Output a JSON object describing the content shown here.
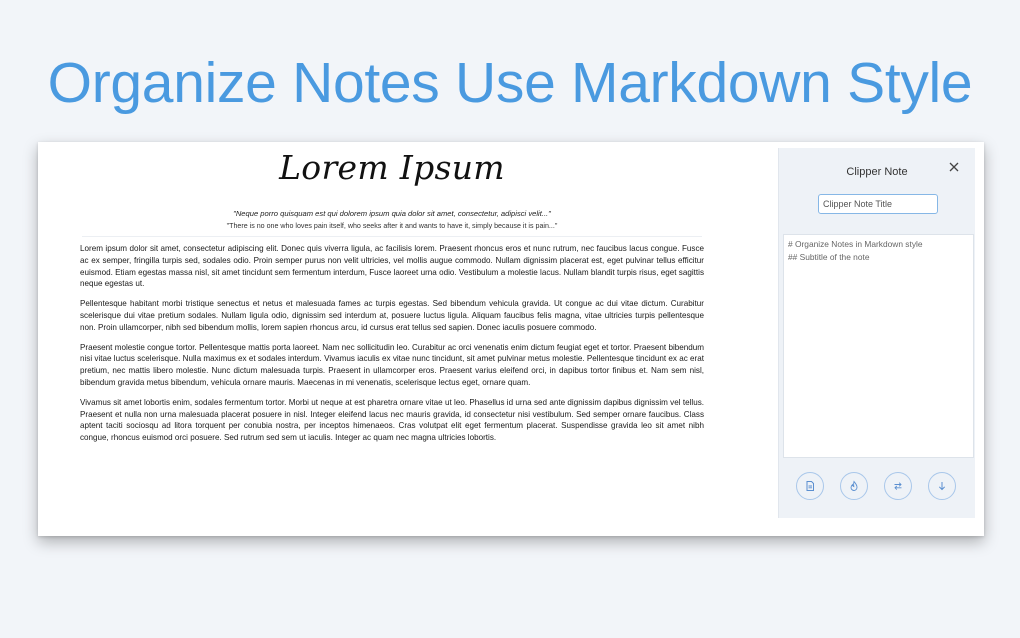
{
  "headline": "Organize Notes Use Markdown Style",
  "article": {
    "title": "Lorem Ipsum",
    "quote": "\"Neque porro quisquam est qui dolorem ipsum quia dolor sit amet, consectetur, adipisci velit...\"",
    "quote_translation": "\"There is no one who loves pain itself, who seeks after it and wants to have it, simply because it is pain...\"",
    "paragraphs": [
      "Lorem ipsum dolor sit amet, consectetur adipiscing elit. Donec quis viverra ligula, ac facilisis lorem. Praesent rhoncus eros et nunc rutrum, nec faucibus lacus congue. Fusce ac ex semper, fringilla turpis sed, sodales odio. Proin semper purus non velit ultricies, vel mollis augue commodo. Nullam dignissim placerat est, eget pulvinar tellus efficitur euismod. Etiam egestas massa nisl, sit amet tincidunt sem fermentum interdum, Fusce laoreet urna odio. Vestibulum a molestie lacus. Nullam blandit turpis risus, eget sagittis neque egestas ut.",
      "Pellentesque habitant morbi tristique senectus et netus et malesuada fames ac turpis egestas. Sed bibendum vehicula gravida. Ut congue ac dui vitae dictum. Curabitur scelerisque dui vitae pretium sodales. Nullam ligula odio, dignissim sed interdum at, posuere luctus ligula. Aliquam faucibus felis magna, vitae ultricies turpis pellentesque non. Proin ullamcorper, nibh sed bibendum mollis, lorem sapien rhoncus arcu, id cursus erat tellus sed sapien. Donec iaculis posuere commodo.",
      "Praesent molestie congue tortor. Pellentesque mattis porta laoreet. Nam nec sollicitudin leo. Curabitur ac orci venenatis enim dictum feugiat eget et tortor. Praesent bibendum nisi vitae luctus scelerisque. Nulla maximus ex et sodales interdum. Vivamus iaculis ex vitae nunc tincidunt, sit amet pulvinar metus molestie. Pellentesque tincidunt ex ac erat pretium, nec mattis libero molestie. Nunc dictum malesuada turpis. Praesent in ullamcorper eros. Praesent varius eleifend orci, in dapibus tortor finibus et. Nam sem nisl, bibendum gravida metus bibendum, vehicula ornare mauris. Maecenas in mi venenatis, scelerisque lectus eget, ornare quam.",
      "Vivamus sit amet lobortis enim, sodales fermentum tortor. Morbi ut neque at est pharetra ornare vitae ut leo. Phasellus id urna sed ante dignissim dapibus dignissim vel tellus. Praesent et nulla non urna malesuada placerat posuere in nisl. Integer eleifend lacus nec mauris gravida, id consectetur nisi vestibulum. Sed semper ornare faucibus. Class aptent taciti sociosqu ad litora torquent per conubia nostra, per inceptos himenaeos. Cras volutpat elit eget fermentum placerat. Suspendisse gravida leo sit amet nibh congue, rhoncus euismod orci posuere. Sed rutrum sed sem ut iaculis. Integer ac quam nec magna ultricies lobortis."
    ]
  },
  "panel": {
    "title": "Clipper Note",
    "title_placeholder": "Clipper Note Title",
    "body_value": "# Organize Notes in Markdown style\n## Subtitle of the note",
    "toolbar_icons": [
      "document-icon",
      "fire-icon",
      "swap-icon",
      "download-icon"
    ]
  },
  "colors": {
    "headline": "#4a9ae0",
    "panel_bg": "#eef2f7",
    "accent_border": "#86b7e6",
    "icon": "#5b8fd0"
  }
}
